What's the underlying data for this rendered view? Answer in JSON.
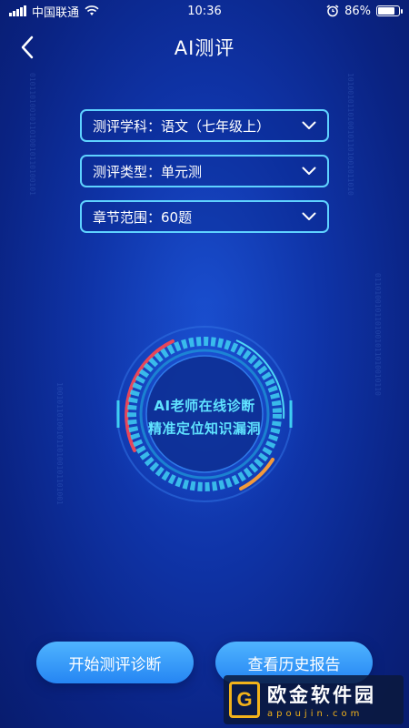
{
  "status_bar": {
    "carrier": "中国联通",
    "time": "10:36",
    "battery": "86%",
    "battery_level": 0.86
  },
  "header": {
    "title": "AI测评"
  },
  "selectors": [
    {
      "label": "测评学科：",
      "value": "语文（七年级上）"
    },
    {
      "label": "测评类型：",
      "value": "单元测"
    },
    {
      "label": "章节范围：",
      "value": "60题"
    }
  ],
  "dial": {
    "line1": "AI老师在线诊断",
    "line2": "精准定位知识漏洞"
  },
  "buttons": {
    "start": "开始测评诊断",
    "history": "查看历史报告"
  },
  "watermark": {
    "title": "欧金软件园",
    "url": "apoujin.com"
  },
  "colors": {
    "accent": "#5fd2ff",
    "button": "#2f93f7",
    "dial_red": "#e8465a",
    "dial_orange": "#f39a3c"
  }
}
